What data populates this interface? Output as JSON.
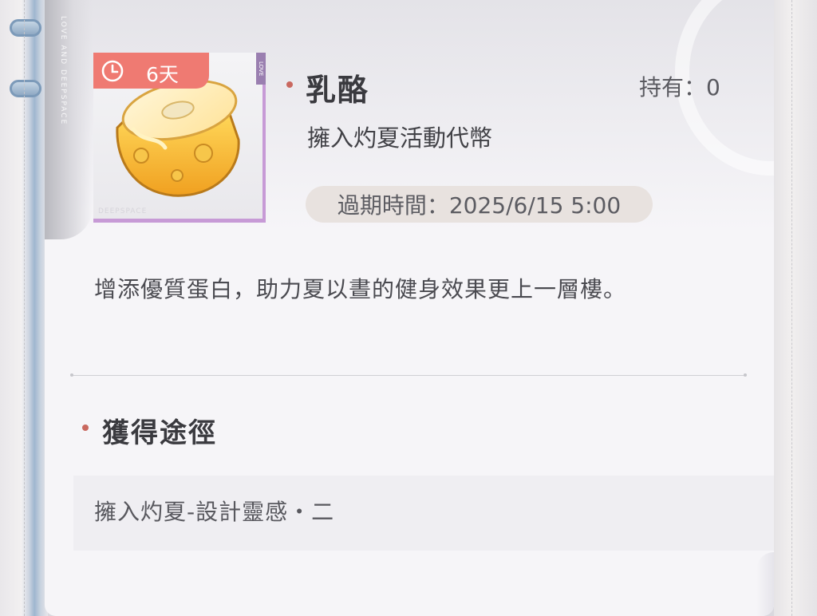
{
  "item": {
    "timer_label": "6天",
    "name": "乳酪",
    "owned": "持有：0",
    "type": "擁入灼夏活動代幣",
    "expire": "過期時間：2025/6/15 5:00",
    "description": "增添優質蛋白，助力夏以晝的健身效果更上一層樓。",
    "thumb_tag": "LOVE",
    "watermark": "DEEPSPACE"
  },
  "sources": {
    "title": "獲得途徑",
    "entries": [
      "擁入灼夏-設計靈感・二"
    ]
  },
  "brand_vertical": "LOVE AND DEEPSPACE",
  "colors": {
    "accent": "#c9685f",
    "badge": "#ef7a72",
    "rarity": "#c79ad6"
  },
  "icons": {
    "timer": "clock-icon",
    "item": "cheese-icon"
  }
}
